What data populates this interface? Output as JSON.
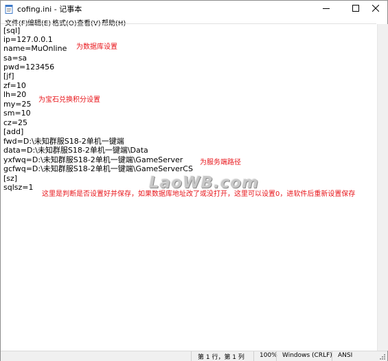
{
  "window": {
    "title": "cofing.ini - 记事本"
  },
  "menu": [
    "文件(F)",
    "编辑(E)",
    "格式(O)",
    "查看(V)",
    "帮助(H)"
  ],
  "editor_lines": [
    "[sql]",
    "ip=127.0.0.1",
    "name=MuOnline",
    "sa=sa",
    "pwd=123456",
    "[jf]",
    "zf=10",
    "lh=20",
    "my=25",
    "sm=10",
    "cz=25",
    "[add]",
    "fwd=D:\\未知群服S18-2单机一键端",
    "data=D:\\未知群服S18-2单机一键端\\Data",
    "yxfwq=D:\\未知群服S18-2单机一键端\\GameServer",
    "gcfwq=D:\\未知群服S18-2单机一键端\\GameServerCS",
    "[sz]",
    "sqlsz=1"
  ],
  "annotations": {
    "db": "为数据库设置",
    "points": "为宝石兑换积分设置",
    "server_path": "为服务端路径",
    "save_note": "这里是判断是否设置好并保存，如果数据库地址改了或没打开，这里可以设置0，进软件后重新设置保存"
  },
  "watermark": "LaoWB.com",
  "status": {
    "position": "第 1 行，第 1 列",
    "zoom": "100%",
    "line_ending": "Windows (CRLF)",
    "encoding": "ANSI"
  },
  "colors": {
    "annotation": "#e8161b",
    "statusbar": "#f0f0f0"
  },
  "icons": {
    "app": "notepad-icon",
    "minimize": "minimize-icon",
    "maximize": "maximize-icon",
    "close": "close-icon",
    "grip": "resize-grip-icon"
  }
}
